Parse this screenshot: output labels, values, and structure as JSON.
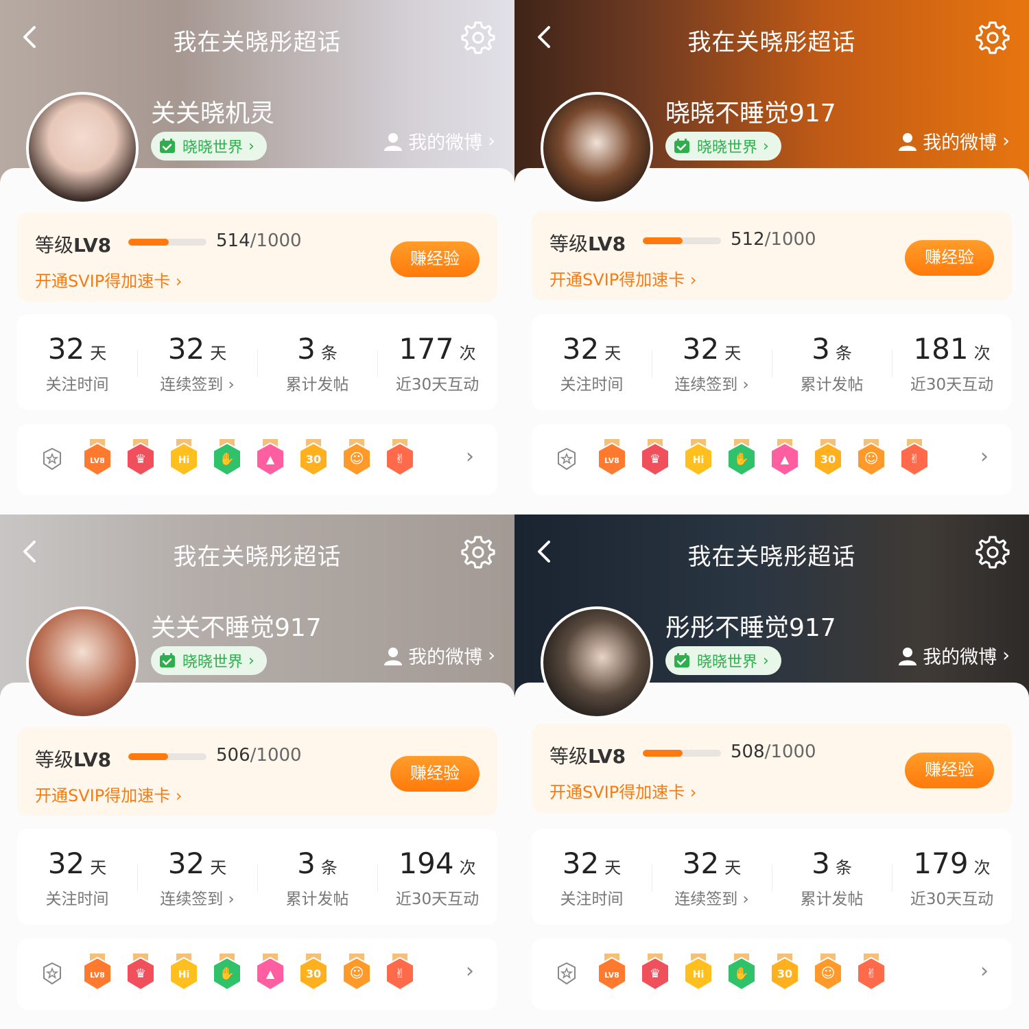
{
  "panels": [
    {
      "title": "我在关晓彤超话",
      "nickname": "关关晓机灵",
      "world_chip": "晓晓世界",
      "my_weibo": "我的微博",
      "level": {
        "prefix": "等级",
        "value": "LV8",
        "exp": "514",
        "total": "/1000",
        "progress": 0.514,
        "svip_link": "开通SVIP得加速卡",
        "earn_button": "赚经验"
      },
      "stats": [
        {
          "num": "32",
          "unit": "天",
          "label": "关注时间"
        },
        {
          "num": "32",
          "unit": "天",
          "label": "连续签到 ›"
        },
        {
          "num": "3",
          "unit": "条",
          "label": "累计发帖"
        },
        {
          "num": "177",
          "unit": "次",
          "label": "近30天互动"
        }
      ],
      "badges": [
        "lv8-badge-icon",
        "trophy-badge-icon",
        "hi-badge-icon",
        "hand-badge-icon",
        "cap-badge-icon",
        "30days-badge-icon",
        "smile-badge-icon",
        "rock-hand-badge-icon"
      ]
    },
    {
      "title": "我在关晓彤超话",
      "nickname": "晓晓不睡觉917",
      "world_chip": "晓晓世界",
      "my_weibo": "我的微博",
      "level": {
        "prefix": "等级",
        "value": "LV8",
        "exp": "512",
        "total": "/1000",
        "progress": 0.512,
        "svip_link": "开通SVIP得加速卡",
        "earn_button": "赚经验"
      },
      "stats": [
        {
          "num": "32",
          "unit": "天",
          "label": "关注时间"
        },
        {
          "num": "32",
          "unit": "天",
          "label": "连续签到 ›"
        },
        {
          "num": "3",
          "unit": "条",
          "label": "累计发帖"
        },
        {
          "num": "181",
          "unit": "次",
          "label": "近30天互动"
        }
      ],
      "badges": [
        "lv8-badge-icon",
        "trophy-badge-icon",
        "hi-badge-icon",
        "hand-badge-icon",
        "cap-badge-icon",
        "30days-badge-icon",
        "smile-badge-icon",
        "rock-hand-badge-icon"
      ]
    },
    {
      "title": "我在关晓彤超话",
      "nickname": "关关不睡觉917",
      "world_chip": "晓晓世界",
      "my_weibo": "我的微博",
      "level": {
        "prefix": "等级",
        "value": "LV8",
        "exp": "506",
        "total": "/1000",
        "progress": 0.506,
        "svip_link": "开通SVIP得加速卡",
        "earn_button": "赚经验"
      },
      "stats": [
        {
          "num": "32",
          "unit": "天",
          "label": "关注时间"
        },
        {
          "num": "32",
          "unit": "天",
          "label": "连续签到 ›"
        },
        {
          "num": "3",
          "unit": "条",
          "label": "累计发帖"
        },
        {
          "num": "194",
          "unit": "次",
          "label": "近30天互动"
        }
      ],
      "badges": [
        "lv8-badge-icon",
        "trophy-badge-icon",
        "hi-badge-icon",
        "hand-badge-icon",
        "cap-badge-icon",
        "30days-badge-icon",
        "smile-badge-icon",
        "rock-hand-badge-icon"
      ]
    },
    {
      "title": "我在关晓彤超话",
      "nickname": "彤彤不睡觉917",
      "world_chip": "晓晓世界",
      "my_weibo": "我的微博",
      "level": {
        "prefix": "等级",
        "value": "LV8",
        "exp": "508",
        "total": "/1000",
        "progress": 0.508,
        "svip_link": "开通SVIP得加速卡",
        "earn_button": "赚经验"
      },
      "stats": [
        {
          "num": "32",
          "unit": "天",
          "label": "关注时间"
        },
        {
          "num": "32",
          "unit": "天",
          "label": "连续签到 ›"
        },
        {
          "num": "3",
          "unit": "条",
          "label": "累计发帖"
        },
        {
          "num": "179",
          "unit": "次",
          "label": "近30天互动"
        }
      ],
      "badges": [
        "lv8-badge-icon",
        "trophy-badge-icon",
        "hi-badge-icon",
        "hand-badge-icon",
        "30days-badge-icon",
        "smile-badge-icon",
        "rock-hand-badge-icon"
      ]
    }
  ],
  "colors": {
    "accent_orange": "#ff7a0e",
    "svip_text": "#f57b12",
    "world_green": "#2fae4d",
    "level_card_bg": "#fff6ec"
  }
}
